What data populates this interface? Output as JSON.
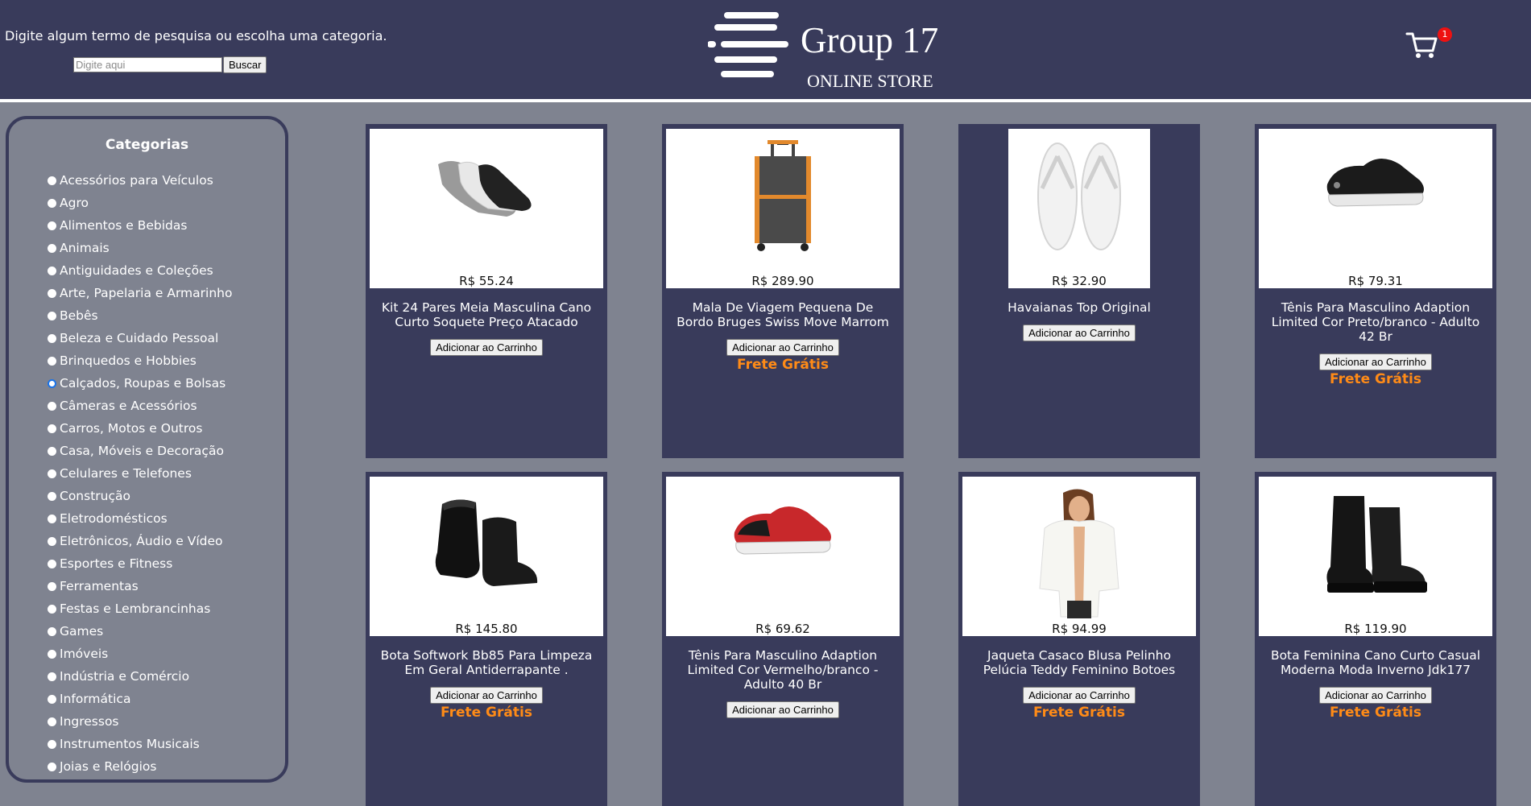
{
  "header": {
    "search_hint": "Digite algum termo de pesquisa ou escolha uma categoria.",
    "search_placeholder": "Digite aqui",
    "search_button": "Buscar",
    "brand_name": "Group 17",
    "brand_tag": "ONLINE STORE",
    "cart_count": "1",
    "icons": {
      "logo": "logo-lines-icon",
      "cart": "cart-icon"
    }
  },
  "sidebar": {
    "title": "Categorias",
    "selected": "Calçados, Roupas e Bolsas",
    "categories": [
      "Acessórios para Veículos",
      "Agro",
      "Alimentos e Bebidas",
      "Animais",
      "Antiguidades e Coleções",
      "Arte, Papelaria e Armarinho",
      "Bebês",
      "Beleza e Cuidado Pessoal",
      "Brinquedos e Hobbies",
      "Calçados, Roupas e Bolsas",
      "Câmeras e Acessórios",
      "Carros, Motos e Outros",
      "Casa, Móveis e Decoração",
      "Celulares e Telefones",
      "Construção",
      "Eletrodomésticos",
      "Eletrônicos, Áudio e Vídeo",
      "Esportes e Fitness",
      "Ferramentas",
      "Festas e Lembrancinhas",
      "Games",
      "Imóveis",
      "Indústria e Comércio",
      "Informática",
      "Ingressos",
      "Instrumentos Musicais",
      "Joias e Relógios"
    ]
  },
  "products": [
    {
      "price": "R$ 55.24",
      "title": "Kit 24 Pares Meia Masculina Cano Curto Soquete Preço Atacado",
      "button": "Adicionar ao Carrinho",
      "free_shipping": "",
      "image": "socks"
    },
    {
      "price": "R$ 289.90",
      "title": "Mala De Viagem Pequena De Bordo Bruges Swiss Move Marrom",
      "button": "Adicionar ao Carrinho",
      "free_shipping": "Frete Grátis",
      "image": "suitcase"
    },
    {
      "price": "R$ 32.90",
      "title": "Havaianas Top Original",
      "button": "Adicionar ao Carrinho",
      "free_shipping": "",
      "image": "flipflops"
    },
    {
      "price": "R$ 79.31",
      "title": "Tênis Para Masculino Adaption Limited Cor Preto/branco - Adulto 42 Br",
      "button": "Adicionar ao Carrinho",
      "free_shipping": "Frete Grátis",
      "image": "sneaker-black"
    },
    {
      "price": "R$ 145.80",
      "title": "Bota Softwork Bb85 Para Limpeza Em Geral Antiderrapante .",
      "button": "Adicionar ao Carrinho",
      "free_shipping": "Frete Grátis",
      "image": "rubber-boots"
    },
    {
      "price": "R$ 69.62",
      "title": "Tênis Para Masculino Adaption Limited Cor Vermelho/branco - Adulto 40 Br",
      "button": "Adicionar ao Carrinho",
      "free_shipping": "",
      "image": "sneaker-red"
    },
    {
      "price": "R$ 94.99",
      "title": "Jaqueta Casaco Blusa Pelinho Pelúcia Teddy Feminino Botoes",
      "button": "Adicionar ao Carrinho",
      "free_shipping": "Frete Grátis",
      "image": "teddy-jacket"
    },
    {
      "price": "R$ 119.90",
      "title": "Bota Feminina Cano Curto Casual Moderna Moda Inverno Jdk177",
      "button": "Adicionar ao Carrinho",
      "free_shipping": "Frete Grátis",
      "image": "ankle-boots"
    }
  ],
  "colors": {
    "header_bg": "#393b5b",
    "page_bg": "#7f8390",
    "card_bg": "#393b5b",
    "free_shipping": "#ff8b17",
    "badge": "#ee1111"
  }
}
